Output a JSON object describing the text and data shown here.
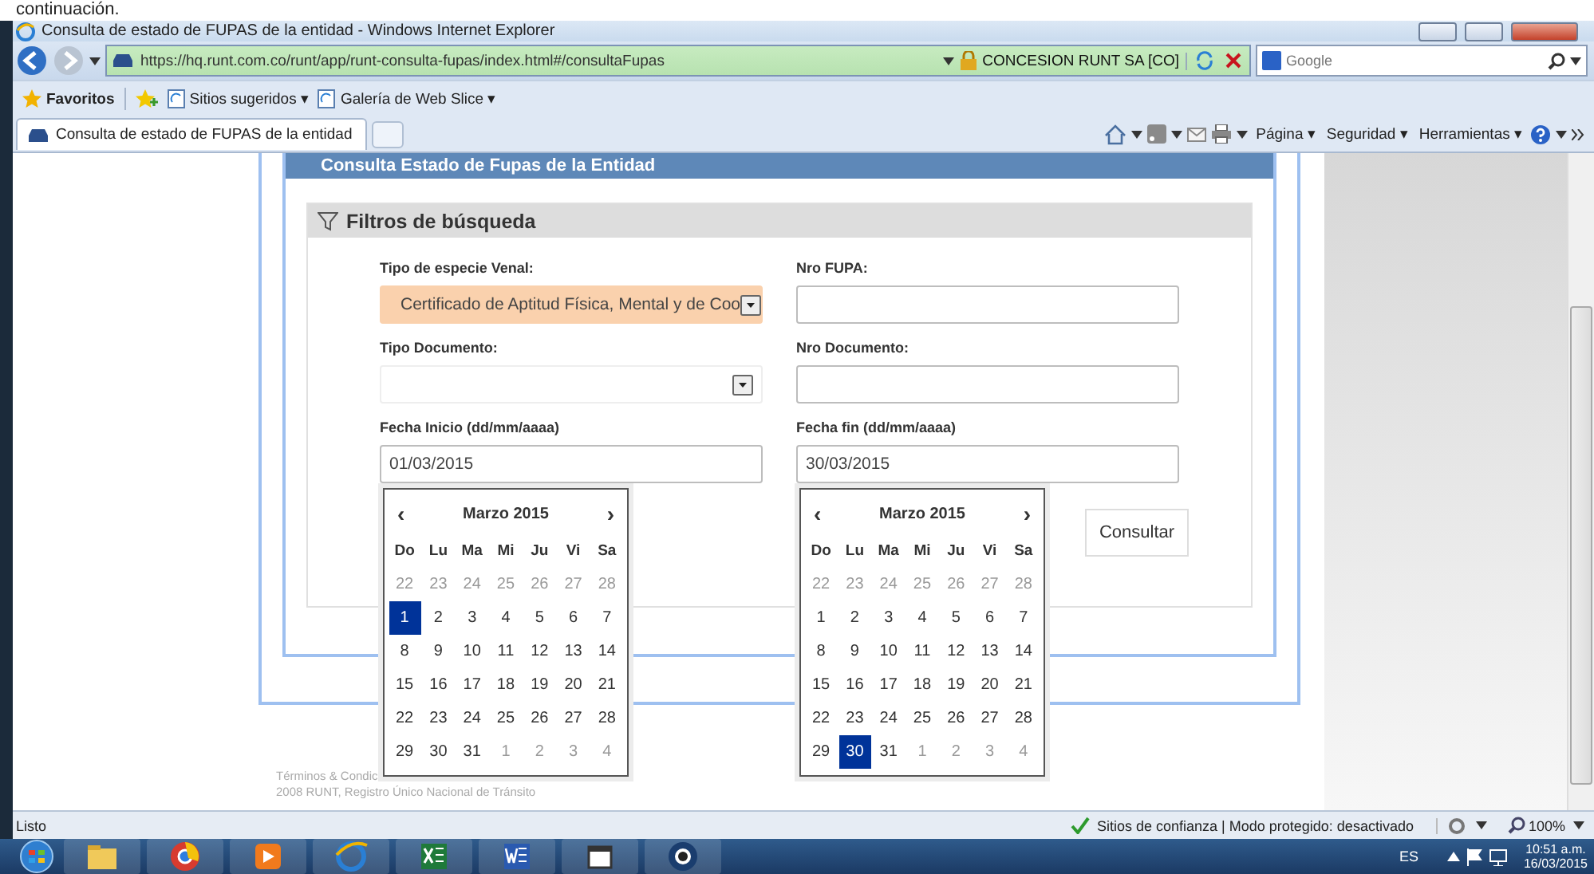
{
  "top_text": "continuación.",
  "window": {
    "title": "Consulta de estado de FUPAS de la entidad - Windows Internet Explorer"
  },
  "address_bar": {
    "url": "https://hq.runt.com.co/runt/app/runt-consulta-fupas/index.html#/consultaFupas",
    "site_identity": "CONCESION RUNT SA [CO]"
  },
  "search": {
    "placeholder": "Google"
  },
  "favorites_bar": {
    "label": "Favoritos",
    "items": [
      "Sitios sugeridos ▾",
      "Galería de Web Slice ▾"
    ]
  },
  "tabs": [
    {
      "label": "Consulta de estado de FUPAS de la entidad",
      "selected": true
    }
  ],
  "command_bar": [
    "Página ▾",
    "Seguridad ▾",
    "Herramientas ▾"
  ],
  "page": {
    "header": "Consulta Estado de Fupas de la Entidad",
    "filters": {
      "title": "Filtros de búsqueda",
      "fields": [
        {
          "label": "Tipo de especie Venal:",
          "kind": "select",
          "value": "Certificado de Aptitud Física, Mental y de Coo",
          "highlighted": true
        },
        {
          "label": "Nro FUPA:",
          "kind": "input"
        },
        {
          "label": "Tipo Documento:",
          "kind": "select",
          "highlighted": false
        },
        {
          "label": "Nro Documento:",
          "kind": "input"
        },
        {
          "label": "Fecha Inicio (dd/mm/aaaa)",
          "kind": "date",
          "value": "01/03/2015"
        },
        {
          "label": "Fecha fin (dd/mm/aaaa)",
          "kind": "date",
          "value": "30/03/2015"
        }
      ],
      "button": "Consultar"
    },
    "calendars": [
      {
        "prev": "‹",
        "month": "Marzo 2015",
        "next": "›",
        "weekdays": [
          "Do",
          "Lu",
          "Ma",
          "Mi",
          "Ju",
          "Vi",
          "Sa"
        ],
        "days": [
          {
            "d": "22",
            "muted": true,
            "selected": false
          },
          {
            "d": "23",
            "muted": true,
            "selected": false
          },
          {
            "d": "24",
            "muted": true,
            "selected": false
          },
          {
            "d": "25",
            "muted": true,
            "selected": false
          },
          {
            "d": "26",
            "muted": true,
            "selected": false
          },
          {
            "d": "27",
            "muted": true,
            "selected": false
          },
          {
            "d": "28",
            "muted": true,
            "selected": false
          },
          {
            "d": "1",
            "muted": false,
            "selected": true
          },
          {
            "d": "2",
            "muted": false,
            "selected": false
          },
          {
            "d": "3",
            "muted": false,
            "selected": false
          },
          {
            "d": "4",
            "muted": false,
            "selected": false
          },
          {
            "d": "5",
            "muted": false,
            "selected": false
          },
          {
            "d": "6",
            "muted": false,
            "selected": false
          },
          {
            "d": "7",
            "muted": false,
            "selected": false
          },
          {
            "d": "8",
            "muted": false,
            "selected": false
          },
          {
            "d": "9",
            "muted": false,
            "selected": false
          },
          {
            "d": "10",
            "muted": false,
            "selected": false
          },
          {
            "d": "11",
            "muted": false,
            "selected": false
          },
          {
            "d": "12",
            "muted": false,
            "selected": false
          },
          {
            "d": "13",
            "muted": false,
            "selected": false
          },
          {
            "d": "14",
            "muted": false,
            "selected": false
          },
          {
            "d": "15",
            "muted": false,
            "selected": false
          },
          {
            "d": "16",
            "muted": false,
            "selected": false
          },
          {
            "d": "17",
            "muted": false,
            "selected": false
          },
          {
            "d": "18",
            "muted": false,
            "selected": false
          },
          {
            "d": "19",
            "muted": false,
            "selected": false
          },
          {
            "d": "20",
            "muted": false,
            "selected": false
          },
          {
            "d": "21",
            "muted": false,
            "selected": false
          },
          {
            "d": "22",
            "muted": false,
            "selected": false
          },
          {
            "d": "23",
            "muted": false,
            "selected": false
          },
          {
            "d": "24",
            "muted": false,
            "selected": false
          },
          {
            "d": "25",
            "muted": false,
            "selected": false
          },
          {
            "d": "26",
            "muted": false,
            "selected": false
          },
          {
            "d": "27",
            "muted": false,
            "selected": false
          },
          {
            "d": "28",
            "muted": false,
            "selected": false
          },
          {
            "d": "29",
            "muted": false,
            "selected": false
          },
          {
            "d": "30",
            "muted": false,
            "selected": false
          },
          {
            "d": "31",
            "muted": false,
            "selected": false
          },
          {
            "d": "1",
            "muted": true,
            "selected": false
          },
          {
            "d": "2",
            "muted": true,
            "selected": false
          },
          {
            "d": "3",
            "muted": true,
            "selected": false
          },
          {
            "d": "4",
            "muted": true,
            "selected": false
          }
        ]
      },
      {
        "prev": "‹",
        "month": "Marzo 2015",
        "next": "›",
        "weekdays": [
          "Do",
          "Lu",
          "Ma",
          "Mi",
          "Ju",
          "Vi",
          "Sa"
        ],
        "days": [
          {
            "d": "22",
            "muted": true,
            "selected": false
          },
          {
            "d": "23",
            "muted": true,
            "selected": false
          },
          {
            "d": "24",
            "muted": true,
            "selected": false
          },
          {
            "d": "25",
            "muted": true,
            "selected": false
          },
          {
            "d": "26",
            "muted": true,
            "selected": false
          },
          {
            "d": "27",
            "muted": true,
            "selected": false
          },
          {
            "d": "28",
            "muted": true,
            "selected": false
          },
          {
            "d": "1",
            "muted": false,
            "selected": false
          },
          {
            "d": "2",
            "muted": false,
            "selected": false
          },
          {
            "d": "3",
            "muted": false,
            "selected": false
          },
          {
            "d": "4",
            "muted": false,
            "selected": false
          },
          {
            "d": "5",
            "muted": false,
            "selected": false
          },
          {
            "d": "6",
            "muted": false,
            "selected": false
          },
          {
            "d": "7",
            "muted": false,
            "selected": false
          },
          {
            "d": "8",
            "muted": false,
            "selected": false
          },
          {
            "d": "9",
            "muted": false,
            "selected": false
          },
          {
            "d": "10",
            "muted": false,
            "selected": false
          },
          {
            "d": "11",
            "muted": false,
            "selected": false
          },
          {
            "d": "12",
            "muted": false,
            "selected": false
          },
          {
            "d": "13",
            "muted": false,
            "selected": false
          },
          {
            "d": "14",
            "muted": false,
            "selected": false
          },
          {
            "d": "15",
            "muted": false,
            "selected": false
          },
          {
            "d": "16",
            "muted": false,
            "selected": false
          },
          {
            "d": "17",
            "muted": false,
            "selected": false
          },
          {
            "d": "18",
            "muted": false,
            "selected": false
          },
          {
            "d": "19",
            "muted": false,
            "selected": false
          },
          {
            "d": "20",
            "muted": false,
            "selected": false
          },
          {
            "d": "21",
            "muted": false,
            "selected": false
          },
          {
            "d": "22",
            "muted": false,
            "selected": false
          },
          {
            "d": "23",
            "muted": false,
            "selected": false
          },
          {
            "d": "24",
            "muted": false,
            "selected": false
          },
          {
            "d": "25",
            "muted": false,
            "selected": false
          },
          {
            "d": "26",
            "muted": false,
            "selected": false
          },
          {
            "d": "27",
            "muted": false,
            "selected": false
          },
          {
            "d": "28",
            "muted": false,
            "selected": false
          },
          {
            "d": "29",
            "muted": false,
            "selected": false
          },
          {
            "d": "30",
            "muted": false,
            "selected": true
          },
          {
            "d": "31",
            "muted": false,
            "selected": false
          },
          {
            "d": "1",
            "muted": true,
            "selected": false
          },
          {
            "d": "2",
            "muted": true,
            "selected": false
          },
          {
            "d": "3",
            "muted": true,
            "selected": false
          },
          {
            "d": "4",
            "muted": true,
            "selected": false
          }
        ]
      }
    ],
    "footer": [
      "Términos & Condic",
      "2008 RUNT, Registro Único Nacional de Tránsito"
    ]
  },
  "status_bar": {
    "text": "Listo",
    "zone": "Sitios de confianza | Modo protegido: desactivado",
    "zoom": "100%"
  },
  "taskbar": {
    "language": "ES",
    "time": "10:51 a.m.",
    "date": "16/03/2015"
  }
}
